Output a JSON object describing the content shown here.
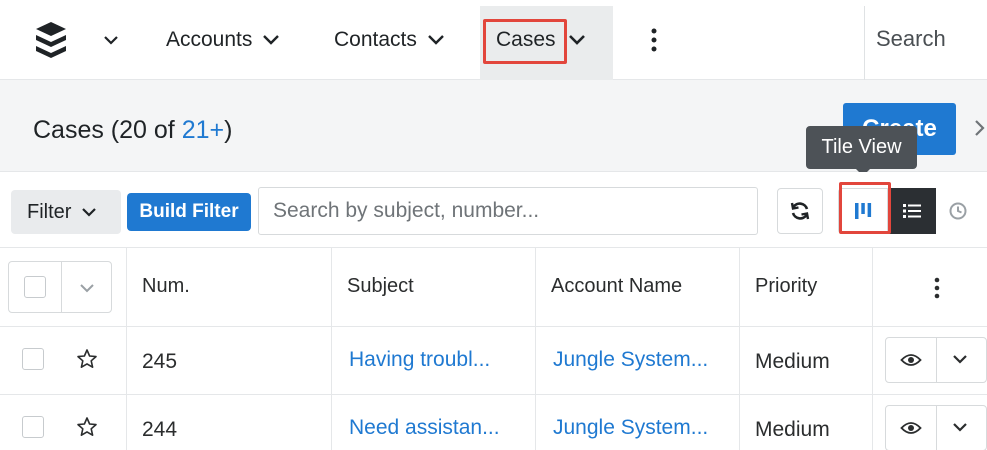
{
  "nav": {
    "logo_icon": "sugar-cube-stack-icon",
    "items": [
      {
        "label": "Accounts"
      },
      {
        "label": "Contacts"
      },
      {
        "label": "Cases"
      }
    ],
    "more_icon": "kebab-icon",
    "search_label": "Search"
  },
  "header": {
    "title": "Cases (20 of ",
    "count": "21+",
    "title_close": ")",
    "create_label": "Create",
    "tooltip": "Tile View"
  },
  "filterbar": {
    "filter_label": "Filter",
    "build_filter_label": "Build Filter",
    "search_placeholder": "Search by subject, number...",
    "search_value": "",
    "view_icons": [
      "refresh-icon",
      "tile-view-icon",
      "list-view-icon",
      "clock-icon"
    ]
  },
  "table": {
    "columns": [
      "Num.",
      "Subject",
      "Account Name",
      "Priority"
    ],
    "rows": [
      {
        "num": "245",
        "subject": "Having troubl...",
        "account": "Jungle System...",
        "priority": "Medium"
      },
      {
        "num": "244",
        "subject": "Need assistan...",
        "account": "Jungle System...",
        "priority": "Medium"
      }
    ]
  },
  "colors": {
    "accent": "#1f79d1",
    "highlight": "#e2463c",
    "tooltip": "#4d5257"
  }
}
